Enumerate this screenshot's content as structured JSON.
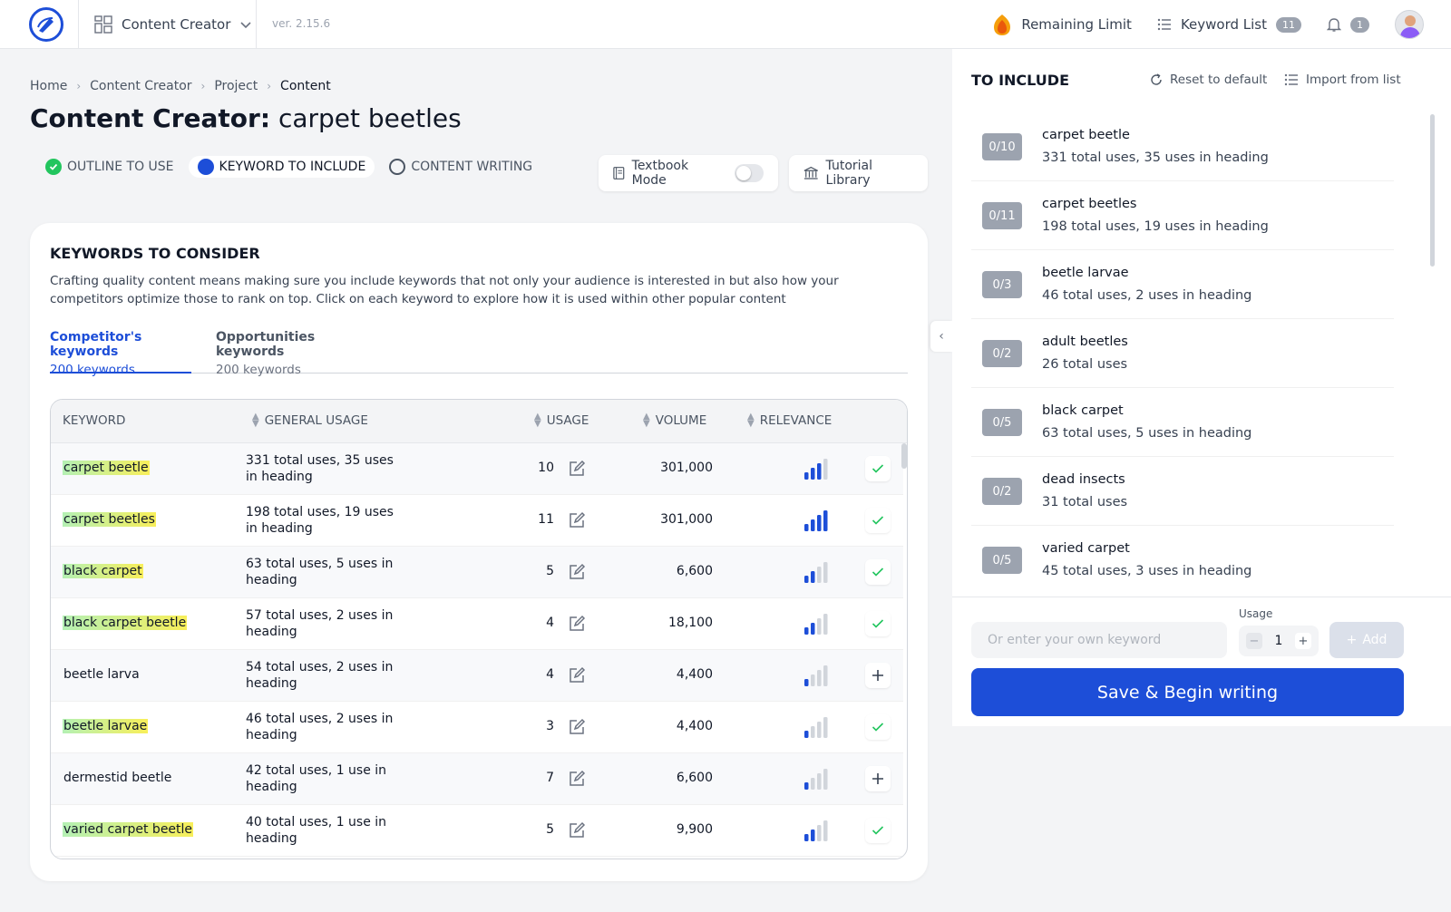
{
  "app": {
    "name": "Content Creator",
    "version": "ver. 2.15.6"
  },
  "topbar": {
    "remaining_limit": "Remaining Limit",
    "keyword_list": "Keyword List",
    "keyword_list_count": "11",
    "notifications_count": "1"
  },
  "breadcrumb": [
    "Home",
    "Content Creator",
    "Project",
    "Content"
  ],
  "page": {
    "title_prefix": "Content Creator:",
    "title_subject": "carpet beetles"
  },
  "steps": [
    {
      "label": "OUTLINE TO USE",
      "state": "done"
    },
    {
      "label": "KEYWORD TO INCLUDE",
      "state": "active"
    },
    {
      "label": "CONTENT WRITING",
      "state": "pending"
    }
  ],
  "toolbar": {
    "textbook_mode": "Textbook Mode",
    "textbook_mode_on": false,
    "tutorial_library": "Tutorial Library"
  },
  "keywords_card": {
    "title": "KEYWORDS TO CONSIDER",
    "description": "Crafting quality content means making sure you include keywords that not only your audience is interested in but also how your competitors optimize those to rank on top. Click on each keyword to explore how it is used within other popular content",
    "tabs": [
      {
        "label": "Competitor's keywords",
        "count": "200 keywords",
        "active": true
      },
      {
        "label": "Opportunities keywords",
        "count": "200 keywords",
        "active": false
      }
    ],
    "columns": {
      "keyword": "KEYWORD",
      "general_usage": "GENERAL USAGE",
      "usage": "USAGE",
      "volume": "VOLUME",
      "relevance": "RELEVANCE"
    },
    "rows": [
      {
        "keyword": "carpet beetle",
        "general_usage": "331 total uses, 35 uses in heading",
        "usage": "10",
        "volume": "301,000",
        "relevance_bars": 3,
        "added": true,
        "highlight": true
      },
      {
        "keyword": "carpet beetles",
        "general_usage": "198 total uses, 19 uses in heading",
        "usage": "11",
        "volume": "301,000",
        "relevance_bars": 4,
        "added": true,
        "highlight": true
      },
      {
        "keyword": "black carpet",
        "general_usage": "63 total uses, 5 uses in heading",
        "usage": "5",
        "volume": "6,600",
        "relevance_bars": 2,
        "added": true,
        "highlight": true
      },
      {
        "keyword": "black carpet beetle",
        "general_usage": "57 total uses, 2 uses in heading",
        "usage": "4",
        "volume": "18,100",
        "relevance_bars": 2,
        "added": true,
        "highlight": true
      },
      {
        "keyword": "beetle larva",
        "general_usage": "54 total uses, 2 uses in heading",
        "usage": "4",
        "volume": "4,400",
        "relevance_bars": 1,
        "added": false,
        "highlight": false
      },
      {
        "keyword": "beetle larvae",
        "general_usage": "46 total uses, 2 uses in heading",
        "usage": "3",
        "volume": "4,400",
        "relevance_bars": 1,
        "added": true,
        "highlight": true
      },
      {
        "keyword": "dermestid beetle",
        "general_usage": "42 total uses, 1 use in heading",
        "usage": "7",
        "volume": "6,600",
        "relevance_bars": 1,
        "added": false,
        "highlight": false
      },
      {
        "keyword": "varied carpet beetle",
        "general_usage": "40 total uses, 1 use in heading",
        "usage": "5",
        "volume": "9,900",
        "relevance_bars": 2,
        "added": true,
        "highlight": true
      }
    ]
  },
  "to_include": {
    "title": "TO INCLUDE",
    "reset": "Reset to default",
    "import": "Import from list",
    "items": [
      {
        "badge": "0/10",
        "keyword": "carpet beetle",
        "detail": "331 total uses, 35 uses in heading"
      },
      {
        "badge": "0/11",
        "keyword": "carpet beetles",
        "detail": "198 total uses, 19 uses in heading"
      },
      {
        "badge": "0/3",
        "keyword": "beetle larvae",
        "detail": "46 total uses, 2 uses in heading"
      },
      {
        "badge": "0/2",
        "keyword": "adult beetles",
        "detail": "26 total uses"
      },
      {
        "badge": "0/5",
        "keyword": "black carpet",
        "detail": "63 total uses, 5 uses in heading"
      },
      {
        "badge": "0/2",
        "keyword": "dead insects",
        "detail": "31 total uses"
      },
      {
        "badge": "0/5",
        "keyword": "varied carpet",
        "detail": "45 total uses, 3 uses in heading"
      }
    ],
    "own_keyword_placeholder": "Or enter your own keyword",
    "usage_label": "Usage",
    "usage_value": "1",
    "add": "Add",
    "save": "Save & Begin writing"
  },
  "colors": {
    "accent": "#1d4ed8",
    "done": "#22c55e",
    "muted_badge": "#9ca3af"
  }
}
